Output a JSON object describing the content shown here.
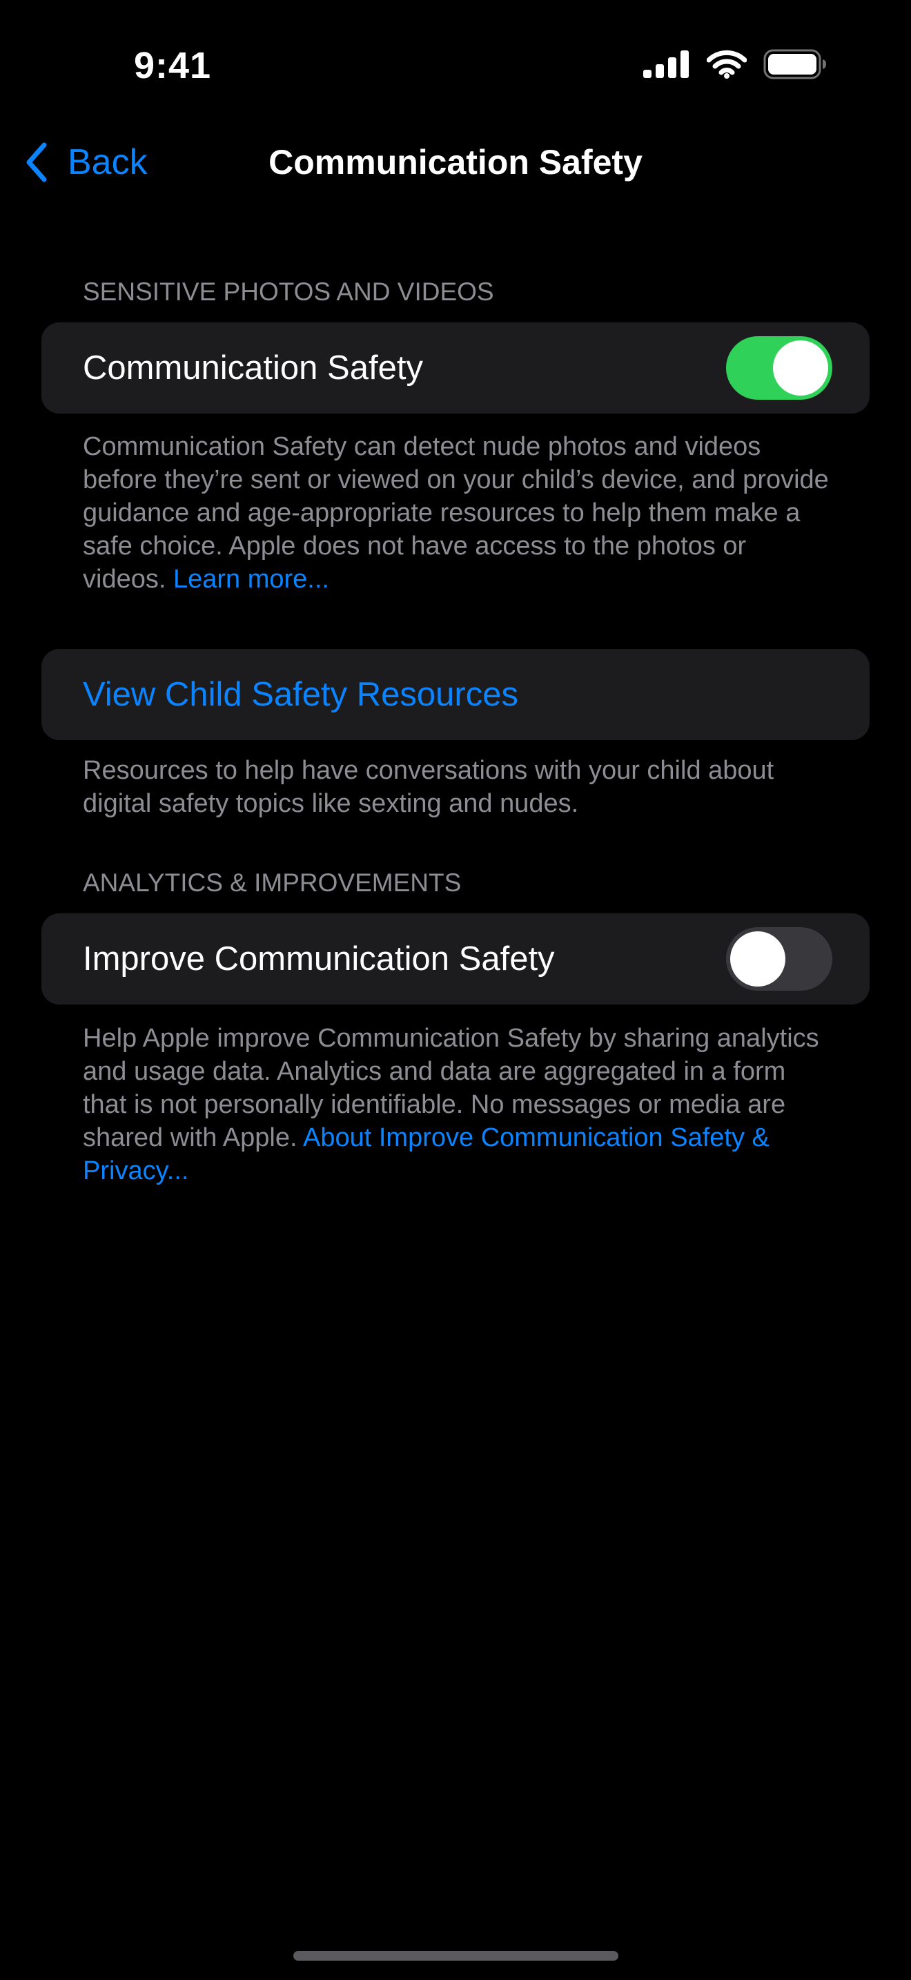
{
  "status_bar": {
    "time": "9:41",
    "icons": [
      "cellular-signal-icon",
      "wifi-icon",
      "battery-icon"
    ]
  },
  "nav": {
    "back_label": "Back",
    "title": "Communication Safety"
  },
  "sections": {
    "sensitive": {
      "header": "SENSITIVE PHOTOS AND VIDEOS",
      "toggle_label": "Communication Safety",
      "toggle_on": true,
      "footer_text": "Communication Safety can detect nude photos and videos before they’re sent or viewed on your child’s device, and provide guidance and age-appropriate resources to help them make a safe choice. Apple does not have access to the photos or videos.",
      "footer_link": "Learn more..."
    },
    "resources": {
      "link_label": "View Child Safety Resources",
      "footer_text": "Resources to help have conversations with your child about digital safety topics like sexting and nudes."
    },
    "analytics": {
      "header": "ANALYTICS & IMPROVEMENTS",
      "toggle_label": "Improve Communication Safety",
      "toggle_on": false,
      "footer_text": "Help Apple improve Communication Safety by sharing analytics and usage data. Analytics and data are aggregated in a form that is not personally identifiable. No messages or media are shared with Apple.",
      "footer_link": "About Improve Communication Safety & Privacy..."
    }
  },
  "colors": {
    "background": "#000000",
    "cell": "#1c1c1e",
    "accent": "#0a84ff",
    "toggle_on": "#30d158",
    "toggle_off": "#39393d",
    "secondary_text": "#8d8d93"
  }
}
